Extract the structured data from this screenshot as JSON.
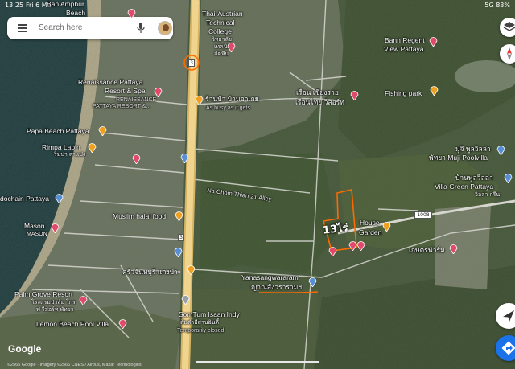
{
  "status_bar": {
    "time": "13:25",
    "date": "Fri 6 Mar",
    "system": "5G 83%"
  },
  "search": {
    "placeholder": "Search here"
  },
  "labels": {
    "ban_amphur": "Ban Amphur",
    "beach": "Beach",
    "thai_austrian": "Thai-Austrian",
    "technical": "Technical",
    "college": "College",
    "college_th_1": "วิทยาลัย",
    "college_th_2": "เทคนิค",
    "college_th_3": "สัตหีบ",
    "bann_regent": "Bann Regent",
    "view_pattaya": "View Pattaya",
    "renaissance_1": "Renaissance Pattaya",
    "renaissance_2": "Resort & Spa",
    "renaissance_3": "RENAISSANCE",
    "renaissance_4": "PATTAYA RESORT &...",
    "ran_pa": "ร้านป้า บ้านอาเกย",
    "as_busy": "As busy as it gets",
    "ruean_chiang": "เรือน เชียงราย",
    "ruean_thai": "เรือนไทย วิสอร์ท",
    "fishing_park": "Fishing park",
    "papa_beach": "Papa Beach Pattaya",
    "rimpa_lapin": "Rimpa Lapin",
    "rimpa_th": "ริมปา ลาแปง",
    "muji_th": "มูจิ พูลวิลล่า",
    "muji": "พัทยา Muji Poolvilla",
    "villa_green_th": "บ้านพูลวิลล่า",
    "villa_green": "Villa Green Pattaya",
    "villa_green_th2": "วิลล่า กรีน",
    "dochain": "dochain Pattaya",
    "na_chom": "Na Chom Thian 21 Alley",
    "muslim_halal": "Muslim halal food",
    "mason": "Mason",
    "mason_th": "MASON",
    "house_garden_1": "House",
    "house_garden_2": "Garden",
    "road_1008": "1008",
    "kaset_farm": "เกษตรฟาร์ม",
    "khrua": "ครัวจันทบุรี แกงป่า",
    "yanasang_1": "Yanasangwararam",
    "yanasang_2": "ญาณสังวรารามฯ",
    "palm_grove": "Palm Grove Resort",
    "palm_grove_th1": "โรงแรมปาล์ม โกร",
    "palm_grove_th2": "ฟ รีสอร์ท พัทยา",
    "lemon_beach": "Lemon Beach Pool Villa",
    "somtum_1": "SomTum Isaan Indy",
    "somtum_2": "ส้มตำอีสานอินดี้",
    "somtum_3": "Temporarily closed",
    "route_3a": "3",
    "route_3b": "3",
    "handwritten": "13ไร่"
  },
  "google_logo": "Google",
  "attribution": "©2565 Google · Imagery ©2565 CNES / Airbus, Maxar Technologies",
  "colors": {
    "highway": "#e8c777",
    "red_pin": "#e24a6c",
    "orange_pin": "#f0a020",
    "blue_pin": "#5a8fd6",
    "boundary": "#ff6a00",
    "direction_button": "#1a73e8"
  }
}
